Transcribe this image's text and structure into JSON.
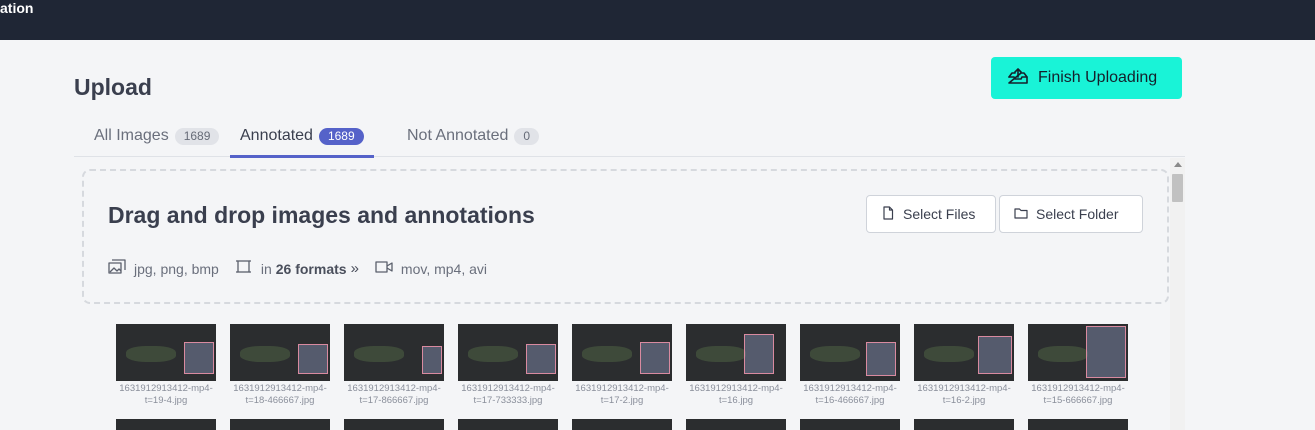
{
  "header": {
    "app_title": "ation"
  },
  "page": {
    "title": "Upload"
  },
  "finish_button": {
    "label": "Finish Uploading"
  },
  "tabs": [
    {
      "label": "All Images",
      "count": "1689",
      "active": false
    },
    {
      "label": "Annotated",
      "count": "1689",
      "active": true
    },
    {
      "label": "Not Annotated",
      "count": "0",
      "active": false
    }
  ],
  "dropzone": {
    "title": "Drag and drop images and annotations",
    "select_files": "Select Files",
    "select_folder": "Select Folder",
    "image_formats": "jpg, png, bmp",
    "annotation_prefix": "in",
    "annotation_formats": "26 formats",
    "video_formats": "mov, mp4, avi"
  },
  "images": [
    {
      "name_line1": "1631912913412-mp4-",
      "name_line2": "t=19-4.jpg"
    },
    {
      "name_line1": "1631912913412-mp4-",
      "name_line2": "t=18-466667.jpg"
    },
    {
      "name_line1": "1631912913412-mp4-",
      "name_line2": "t=17-866667.jpg"
    },
    {
      "name_line1": "1631912913412-mp4-",
      "name_line2": "t=17-733333.jpg"
    },
    {
      "name_line1": "1631912913412-mp4-",
      "name_line2": "t=17-2.jpg"
    },
    {
      "name_line1": "1631912913412-mp4-",
      "name_line2": "t=16.jpg"
    },
    {
      "name_line1": "1631912913412-mp4-",
      "name_line2": "t=16-466667.jpg"
    },
    {
      "name_line1": "1631912913412-mp4-",
      "name_line2": "t=16-2.jpg"
    },
    {
      "name_line1": "1631912913412-mp4-",
      "name_line2": "t=15-666667.jpg"
    }
  ],
  "colors": {
    "accent": "#5562c9",
    "finish_button": "#19f3d7",
    "topbar": "#1f2635",
    "annotation_box": "#d98aa0"
  },
  "icons": {
    "finish": "upload-tray-icon",
    "select_files": "file-icon",
    "select_folder": "folder-icon",
    "image_formats": "images-icon",
    "annotation_formats": "bounding-box-icon",
    "more": "double-chevron-right-icon",
    "video_formats": "video-camera-icon"
  }
}
